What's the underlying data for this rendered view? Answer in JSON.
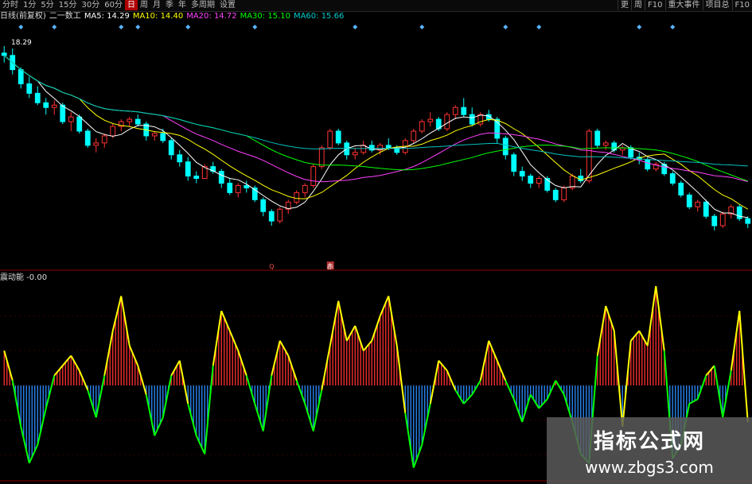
{
  "toolbar": {
    "left": [
      "分时",
      "1分",
      "5分",
      "15分",
      "30分",
      "60分",
      "日",
      "周",
      "月",
      "季",
      "年",
      "多周期",
      "设置"
    ],
    "active_index": 6,
    "right": [
      "更",
      "周",
      "F10",
      "重大事件",
      "项目总",
      "F10"
    ]
  },
  "ma_header": {
    "prefix": "日线(前复权)",
    "name": "二一数工",
    "items": [
      {
        "label": "MA5: 14.29",
        "color": "#ffffff"
      },
      {
        "label": "MA10: 14.40",
        "color": "#ffff00"
      },
      {
        "label": "MA20: 14.72",
        "color": "#ff40ff"
      },
      {
        "label": "MA30: 15.10",
        "color": "#00ff00"
      },
      {
        "label": "MA60: 15.66",
        "color": "#00c0c0"
      }
    ]
  },
  "price_label": "18.29",
  "markers": {
    "q": "Q",
    "red": "赤"
  },
  "indicator_title": "震动能 -0.00",
  "watermark": {
    "line1": "指标公式网",
    "line2": "www.zbgs3.com"
  },
  "colors": {
    "up": "#ff3232",
    "down": "#00ffff",
    "hist_pos": "#ff3030",
    "hist_neg": "#2a8cff",
    "outline_pos": "#ffff00",
    "outline_neg": "#00ff00",
    "ma5": "#ffffff",
    "ma10": "#ffff00",
    "ma20": "#ff40ff",
    "ma30": "#00ff00",
    "ma60": "#00c0c0"
  },
  "chart_data": [
    {
      "type": "candlestick",
      "ylim": [
        10.6,
        19.0
      ],
      "candles": [
        [
          18.1,
          18.4,
          17.7,
          18.0
        ],
        [
          18.0,
          18.3,
          17.2,
          17.4
        ],
        [
          17.4,
          17.5,
          16.6,
          16.8
        ],
        [
          16.8,
          17.1,
          16.2,
          16.4
        ],
        [
          16.4,
          16.7,
          15.9,
          16.0
        ],
        [
          16.0,
          16.2,
          15.5,
          15.8
        ],
        [
          15.8,
          16.1,
          15.5,
          15.9
        ],
        [
          15.9,
          16.0,
          15.1,
          15.2
        ],
        [
          15.2,
          15.6,
          14.8,
          15.4
        ],
        [
          15.4,
          15.5,
          14.7,
          14.8
        ],
        [
          14.8,
          14.9,
          14.1,
          14.2
        ],
        [
          14.2,
          14.5,
          13.9,
          14.3
        ],
        [
          14.3,
          14.7,
          14.1,
          14.6
        ],
        [
          14.6,
          15.1,
          14.5,
          15.0
        ],
        [
          15.0,
          15.3,
          14.8,
          15.2
        ],
        [
          15.2,
          15.4,
          15.0,
          15.3
        ],
        [
          15.3,
          15.5,
          15.0,
          15.1
        ],
        [
          15.1,
          15.2,
          14.4,
          14.6
        ],
        [
          14.6,
          14.8,
          14.4,
          14.7
        ],
        [
          14.7,
          14.9,
          14.3,
          14.4
        ],
        [
          14.4,
          14.5,
          13.6,
          13.8
        ],
        [
          13.8,
          14.0,
          13.3,
          13.5
        ],
        [
          13.5,
          13.7,
          12.7,
          12.9
        ],
        [
          12.9,
          13.1,
          12.6,
          12.8
        ],
        [
          12.8,
          13.4,
          12.8,
          13.3
        ],
        [
          13.3,
          13.5,
          13.0,
          13.1
        ],
        [
          13.1,
          13.2,
          12.4,
          12.6
        ],
        [
          12.6,
          12.8,
          12.1,
          12.2
        ],
        [
          12.2,
          12.6,
          12.0,
          12.5
        ],
        [
          12.5,
          12.7,
          12.2,
          12.4
        ],
        [
          12.4,
          12.5,
          11.8,
          11.9
        ],
        [
          11.9,
          12.0,
          11.2,
          11.4
        ],
        [
          11.4,
          11.5,
          10.8,
          11.0
        ],
        [
          11.0,
          11.6,
          10.9,
          11.5
        ],
        [
          11.5,
          11.9,
          11.3,
          11.8
        ],
        [
          11.8,
          12.3,
          11.7,
          12.2
        ],
        [
          12.2,
          12.6,
          12.0,
          12.5
        ],
        [
          12.5,
          13.4,
          12.4,
          13.3
        ],
        [
          13.3,
          14.2,
          13.2,
          14.1
        ],
        [
          14.1,
          14.9,
          14.0,
          14.8
        ],
        [
          14.8,
          14.9,
          14.2,
          14.3
        ],
        [
          14.3,
          14.4,
          13.6,
          13.8
        ],
        [
          13.8,
          14.1,
          13.6,
          13.9
        ],
        [
          13.9,
          14.4,
          13.8,
          14.2
        ],
        [
          14.2,
          14.4,
          13.9,
          14.0
        ],
        [
          14.0,
          14.3,
          13.8,
          14.2
        ],
        [
          14.2,
          14.5,
          14.0,
          14.1
        ],
        [
          14.1,
          14.2,
          13.8,
          13.9
        ],
        [
          13.9,
          14.5,
          13.8,
          14.4
        ],
        [
          14.4,
          14.9,
          14.3,
          14.8
        ],
        [
          14.8,
          15.3,
          14.7,
          15.2
        ],
        [
          15.2,
          15.6,
          15.0,
          15.3
        ],
        [
          15.3,
          15.4,
          14.8,
          14.9
        ],
        [
          14.9,
          15.6,
          14.8,
          15.5
        ],
        [
          15.5,
          15.9,
          15.3,
          15.8
        ],
        [
          15.8,
          16.2,
          15.4,
          15.5
        ],
        [
          15.5,
          15.8,
          15.0,
          15.1
        ],
        [
          15.1,
          15.6,
          15.0,
          15.5
        ],
        [
          15.5,
          15.7,
          15.2,
          15.3
        ],
        [
          15.3,
          15.4,
          14.3,
          14.5
        ],
        [
          14.5,
          14.6,
          13.6,
          13.8
        ],
        [
          13.8,
          13.9,
          12.9,
          13.1
        ],
        [
          13.1,
          13.3,
          12.7,
          12.9
        ],
        [
          12.9,
          13.0,
          12.4,
          12.6
        ],
        [
          12.6,
          12.9,
          12.4,
          12.8
        ],
        [
          12.8,
          12.9,
          12.2,
          12.3
        ],
        [
          12.3,
          12.4,
          11.8,
          11.9
        ],
        [
          11.9,
          12.5,
          11.8,
          12.4
        ],
        [
          12.4,
          13.0,
          12.3,
          12.9
        ],
        [
          12.9,
          13.2,
          12.6,
          12.7
        ],
        [
          12.7,
          14.9,
          12.6,
          14.8
        ],
        [
          14.8,
          14.9,
          14.1,
          14.2
        ],
        [
          14.2,
          14.4,
          14.0,
          14.3
        ],
        [
          14.3,
          14.4,
          13.9,
          14.0
        ],
        [
          14.0,
          14.2,
          13.8,
          14.1
        ],
        [
          14.1,
          14.2,
          13.6,
          13.7
        ],
        [
          13.7,
          13.9,
          13.4,
          13.6
        ],
        [
          13.6,
          13.7,
          13.1,
          13.2
        ],
        [
          13.2,
          13.5,
          13.1,
          13.4
        ],
        [
          13.4,
          13.5,
          12.9,
          13.0
        ],
        [
          13.0,
          13.1,
          12.5,
          12.6
        ],
        [
          12.6,
          12.7,
          12.0,
          12.1
        ],
        [
          12.1,
          12.2,
          11.5,
          11.6
        ],
        [
          11.6,
          11.9,
          11.4,
          11.8
        ],
        [
          11.8,
          11.9,
          11.1,
          11.2
        ],
        [
          11.2,
          11.3,
          10.6,
          10.8
        ],
        [
          10.8,
          11.4,
          10.7,
          11.3
        ],
        [
          11.3,
          11.7,
          11.1,
          11.6
        ],
        [
          11.6,
          11.7,
          11.0,
          11.1
        ],
        [
          11.1,
          11.2,
          10.7,
          10.9
        ]
      ]
    },
    {
      "type": "histogram",
      "ylim": [
        -1.0,
        1.0
      ],
      "values": [
        0.35,
        0.05,
        -0.45,
        -0.85,
        -0.65,
        -0.25,
        0.1,
        0.2,
        0.3,
        0.15,
        -0.05,
        -0.35,
        0.1,
        0.55,
        0.9,
        0.4,
        0.2,
        -0.1,
        -0.55,
        -0.35,
        0.1,
        0.25,
        -0.2,
        -0.55,
        -0.75,
        0.2,
        0.75,
        0.55,
        0.35,
        0.1,
        -0.2,
        -0.5,
        0.1,
        0.45,
        0.3,
        0.05,
        -0.2,
        -0.5,
        -0.05,
        0.4,
        0.85,
        0.45,
        0.6,
        0.35,
        0.45,
        0.7,
        0.9,
        0.4,
        -0.3,
        -0.9,
        -0.65,
        -0.2,
        0.25,
        0.15,
        -0.05,
        -0.2,
        -0.1,
        0.05,
        0.45,
        0.25,
        0.05,
        -0.15,
        -0.4,
        -0.1,
        -0.25,
        -0.15,
        0.05,
        -0.1,
        -0.4,
        -0.75,
        -0.85,
        0.3,
        0.8,
        0.55,
        -0.45,
        0.45,
        0.55,
        0.4,
        1.0,
        0.35,
        -0.8,
        -0.65,
        -0.2,
        -0.15,
        0.1,
        0.2,
        -0.35,
        0.15,
        0.75,
        -0.4
      ]
    }
  ]
}
